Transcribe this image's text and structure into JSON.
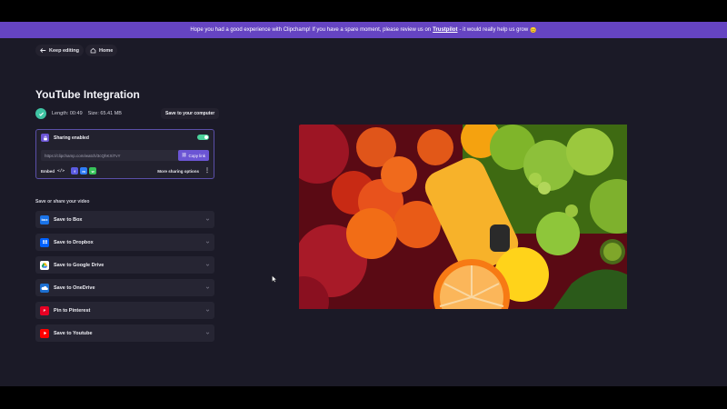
{
  "banner": {
    "text_before": "Hope you had a good experience with Clipchamp! If you have a spare moment, please review us on",
    "link": "Trustpilot",
    "text_after": "- it would really help us grow",
    "emoji": "😊"
  },
  "nav": {
    "keep_editing": "Keep editing",
    "home": "Home"
  },
  "page": {
    "title": "YouTube Integration",
    "length_label": "Length: 00:49",
    "size_label": "Size: 65.41 MB",
    "save_computer": "Save to your computer"
  },
  "sharing": {
    "label": "Sharing enabled",
    "enabled": true,
    "url": "https://clipchamp.com/watch/3cQhKXiTvY",
    "copy_label": "Copy link",
    "embed_label": "Embed",
    "more_label": "More sharing options",
    "social_icons": [
      "facebook-icon",
      "messenger-icon",
      "whatsapp-icon"
    ]
  },
  "save_section": {
    "label": "Save or share your video",
    "items": [
      {
        "label": "Save to Box",
        "icon": "box-icon",
        "color": "#1a73e8"
      },
      {
        "label": "Save to Dropbox",
        "icon": "dropbox-icon",
        "color": "#0061fe"
      },
      {
        "label": "Save to Google Drive",
        "icon": "google-drive-icon",
        "color": "#ffffff"
      },
      {
        "label": "Save to OneDrive",
        "icon": "onedrive-icon",
        "color": "#1c6fd1"
      },
      {
        "label": "Pin to Pinterest",
        "icon": "pinterest-icon",
        "color": "#e60023"
      },
      {
        "label": "Save to Youtube",
        "icon": "youtube-icon",
        "color": "#ff0000"
      }
    ]
  },
  "colors": {
    "accent": "#6b55d4",
    "banner": "#6544c2",
    "success": "#3fc3a3"
  }
}
